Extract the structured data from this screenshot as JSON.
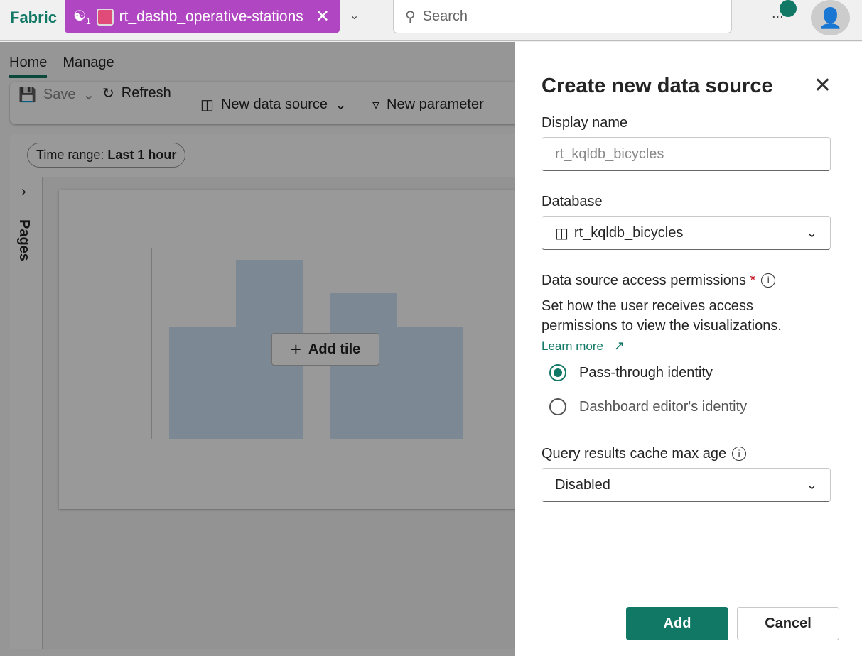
{
  "topbar": {
    "brand": "Fabric",
    "tab_title": "rt_dashb_operative-stations",
    "workspace_count": "1",
    "search_placeholder": "Search",
    "more": "..."
  },
  "ribbon": {
    "tabs": [
      "Home",
      "Manage"
    ],
    "save": "Save",
    "refresh": "Refresh",
    "new_data_source": "New data source",
    "new_parameter": "New parameter"
  },
  "filters": {
    "time_range_label": "Time range:",
    "time_range_value": "Last 1 hour"
  },
  "pages": {
    "label": "Pages"
  },
  "canvas": {
    "add_tile": "Add tile"
  },
  "panel": {
    "title": "Create new data source",
    "display_name_label": "Display name",
    "display_name_placeholder": "rt_kqldb_bicycles",
    "database_label": "Database",
    "database_value": "rt_kqldb_bicycles",
    "permissions_label": "Data source access permissions",
    "required_mark": "*",
    "permissions_desc": "Set how the user receives access permissions to view the visualizations.",
    "learn_more": "Learn more",
    "options": [
      "Pass-through identity",
      "Dashboard editor's identity"
    ],
    "selected_option": "Pass-through identity",
    "cache_label": "Query results cache max age",
    "cache_value": "Disabled",
    "add": "Add",
    "cancel": "Cancel"
  }
}
